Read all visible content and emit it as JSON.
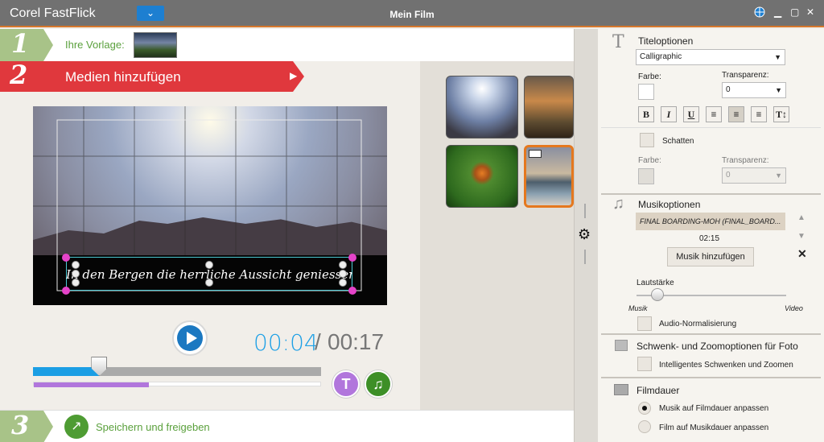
{
  "titlebar": {
    "app_name": "Corel FastFlick",
    "menu_icon": "chevron-down-icon",
    "window_title": "Mein Film"
  },
  "step1": {
    "number": "1",
    "label": "Ihre Vorlage:"
  },
  "step2": {
    "number": "2",
    "label": "Medien hinzufügen"
  },
  "step3": {
    "number": "3",
    "label": "Speichern und freigeben"
  },
  "preview": {
    "caption": "In den Bergen die herrliche Aussicht geniessen"
  },
  "playback": {
    "current_time": "00:04",
    "separator": "/",
    "total_time": "00:17",
    "progress": 0.23,
    "title_track": 0.4
  },
  "buttons": {
    "title_icon_label": "T",
    "music_icon_label": "♫"
  },
  "title_options": {
    "heading": "Titeloptionen",
    "font": "Calligraphic",
    "color_label": "Farbe:",
    "transparency_label": "Transparenz:",
    "transparency_value": "0",
    "format_buttons": [
      "B",
      "I",
      "U",
      "≡",
      "≡",
      "≡",
      "T↕"
    ],
    "shadow_label": "Schatten",
    "shadow_color_label": "Farbe:",
    "shadow_transparency_label": "Transparenz:",
    "shadow_transparency_value": "0"
  },
  "music_options": {
    "heading": "Musikoptionen",
    "file": "FINAL BOARDING-MOH (FINAL_BOARD...",
    "duration": "02:15",
    "add_button": "Musik hinzufügen",
    "volume_label": "Lautstärke",
    "slider_left": "Musik",
    "slider_right": "Video",
    "volume_position": 0.14,
    "normalize_label": "Audio-Normalisierung"
  },
  "pan_zoom": {
    "heading": "Schwenk- und Zoomoptionen für Foto",
    "smart_label": "Intelligentes Schwenken und Zoomen"
  },
  "movie_duration": {
    "heading": "Filmdauer",
    "option1": "Musik auf Filmdauer anpassen",
    "option2": "Film auf Musikdauer anpassen"
  },
  "colors": {
    "accent_blue": "#1b78c1",
    "step2_red": "#e0383d",
    "timeline_blue": "#1b9ee4",
    "title_purple": "#b176dc",
    "music_green": "#3d8f27"
  }
}
